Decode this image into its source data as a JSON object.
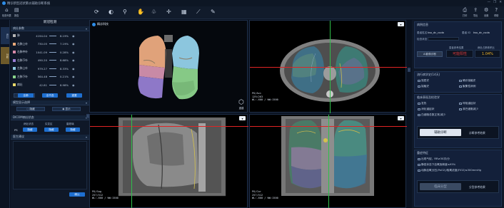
{
  "titlebar": {
    "title": "精诊新型冠状肺炎辅助诊断系统"
  },
  "window_controls": [
    "—",
    "❐",
    "✕"
  ],
  "toolbar": {
    "left_buttons": [
      {
        "icon": "home-icon",
        "glyph": "⌂",
        "label": "检查列表"
      },
      {
        "icon": "report-icon",
        "glyph": "▤",
        "label": "报告"
      }
    ],
    "tools": [
      {
        "icon": "rotate-icon",
        "glyph": "⟳"
      },
      {
        "icon": "contrast-icon",
        "glyph": "◐"
      },
      {
        "icon": "zoom-icon",
        "glyph": "⚲"
      },
      {
        "icon": "pan-icon",
        "glyph": "✋"
      },
      {
        "icon": "lung-icon",
        "glyph": "♧"
      },
      {
        "icon": "crosshair-icon",
        "glyph": "✛"
      },
      {
        "icon": "layout-icon",
        "glyph": "▦"
      },
      {
        "icon": "measure-icon",
        "glyph": "⟋"
      },
      {
        "icon": "annotate-icon",
        "glyph": "✎"
      }
    ],
    "right_buttons": [
      {
        "icon": "print-icon",
        "glyph": "⎙",
        "label": "打印"
      },
      {
        "icon": "export-icon",
        "glyph": "⇪",
        "label": "导出"
      },
      {
        "icon": "settings-icon",
        "glyph": "⚙",
        "label": "设置"
      },
      {
        "icon": "help-icon",
        "glyph": "?",
        "label": "帮助"
      }
    ]
  },
  "left_strip": {
    "tabs": [
      "病灶",
      "分析"
    ]
  },
  "left_panel": {
    "header": "新冠检测",
    "lesion_section": {
      "title": "病灶参数",
      "rows": [
        {
          "name": "肺",
          "value": "4194.04",
          "percent": "8.19%",
          "color": "#b5b5b5"
        },
        {
          "name": "右肺上叶",
          "value": "730.05",
          "percent": "7.19%",
          "color": "#e8a97a"
        },
        {
          "name": "右肺中叶",
          "value": "1041.09",
          "percent": "0.28%",
          "color": "#d98aa8"
        },
        {
          "name": "右肺下叶",
          "value": "490.20",
          "percent": "8.68%",
          "color": "#9b7fd6"
        },
        {
          "name": "左肺上叶",
          "value": "979.27",
          "percent": "8.33%",
          "color": "#8ec9e0"
        },
        {
          "name": "左肺下叶",
          "value": "564.48",
          "percent": "0.21%",
          "color": "#8bd48b"
        },
        {
          "name": "病灶",
          "value": "42.81",
          "percent": "8.98%",
          "color": "#e8d86a"
        }
      ],
      "buttons": [
        "全肺",
        "全不选",
        "重置"
      ]
    },
    "display_section": {
      "title": "模型显示选择",
      "buttons": [
        "隐藏",
        "显示"
      ]
    },
    "model_section": {
      "title": "DICOM病灶状态",
      "columns": [
        "病灶状态",
        "实变区",
        "磨玻璃"
      ],
      "row_label": "PS",
      "row_values": [
        "隐藏",
        "隐藏",
        "隐藏"
      ]
    },
    "advice_section": {
      "title": "医生建议"
    },
    "confirm_button": "确认"
  },
  "viewports": {
    "v3d": {
      "brand": "精诊科技",
      "label": "重建",
      "icon": "cube-icon"
    },
    "axial": {
      "lines": [
        "PO/Axi",
        "129/263",
        "WL:-600 / WW:1500"
      ]
    },
    "sagittal": {
      "lines": [
        "PO/Sag",
        "257/512",
        "WL:-600 / WW:1500"
      ]
    },
    "coronal": {
      "lines": [
        "PO/Cor",
        "257/512",
        "WL:-600 / WW:1500"
      ]
    }
  },
  "right_panel": {
    "patient_section": {
      "title": "病例信息",
      "name_label": "患者姓名",
      "name_value": "ksu_dc_cuda",
      "id_label": "患者 ID",
      "id_value": "ksu_dc_cuda",
      "state_label": "检查状态",
      "result_labels": [
        "患者参考结果",
        "病灶占肺体积比"
      ],
      "ai_button": "AI影像诊断",
      "result_value": "可能阳性",
      "percent_value": "1.04%"
    },
    "history_section": {
      "title": "流行病学史(14天)",
      "items": [
        "旅居史",
        "接触史",
        "聚集性",
        "确诊接触史",
        "聚集性病例"
      ]
    },
    "symptom_section": {
      "title": "临床表现及检验学",
      "items": [
        "发热",
        "呼吸道症状",
        "消化道症状",
        "淋巴细胞减少",
        "白细胞总数正常/减少"
      ]
    },
    "diagnosis_button": "辅助诊断",
    "diagnosis_result_label": "诊断参考结果",
    "severity_section": {
      "title": "重症特征",
      "items": [
        "出现气促，RR≥30次/分",
        "静息状态下血氧饱和度≤93%",
        "动脉血氧分压(PaO2)/吸氧浓度(FiO2)≤300mmHg"
      ]
    },
    "grade_button": "临床分型",
    "grade_label": "分型参考结果"
  },
  "colors": {
    "accent": "#1e6fd0",
    "positive": "#e23b3b",
    "percent": "#f0b429",
    "crosshair_red": "#e02424",
    "crosshair_green": "#2fbf4a"
  }
}
